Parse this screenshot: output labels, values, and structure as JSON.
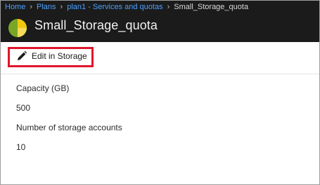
{
  "breadcrumb": {
    "home": "Home",
    "plans": "Plans",
    "plan": "plan1 - Services and quotas",
    "current": "Small_Storage_quota"
  },
  "header": {
    "title": "Small_Storage_quota",
    "icon": "quota-pie-icon"
  },
  "toolbar": {
    "edit_label": "Edit in Storage",
    "edit_icon": "pencil-icon",
    "highlight_color": "#e0162b"
  },
  "fields": [
    {
      "label": "Capacity (GB)",
      "value": "500"
    },
    {
      "label": "Number of storage accounts",
      "value": "10"
    }
  ],
  "colors": {
    "header_bg": "#1b1b1b",
    "link": "#4aa0ff",
    "icon_green": "#7aa627",
    "icon_yellow": "#f2c811"
  }
}
